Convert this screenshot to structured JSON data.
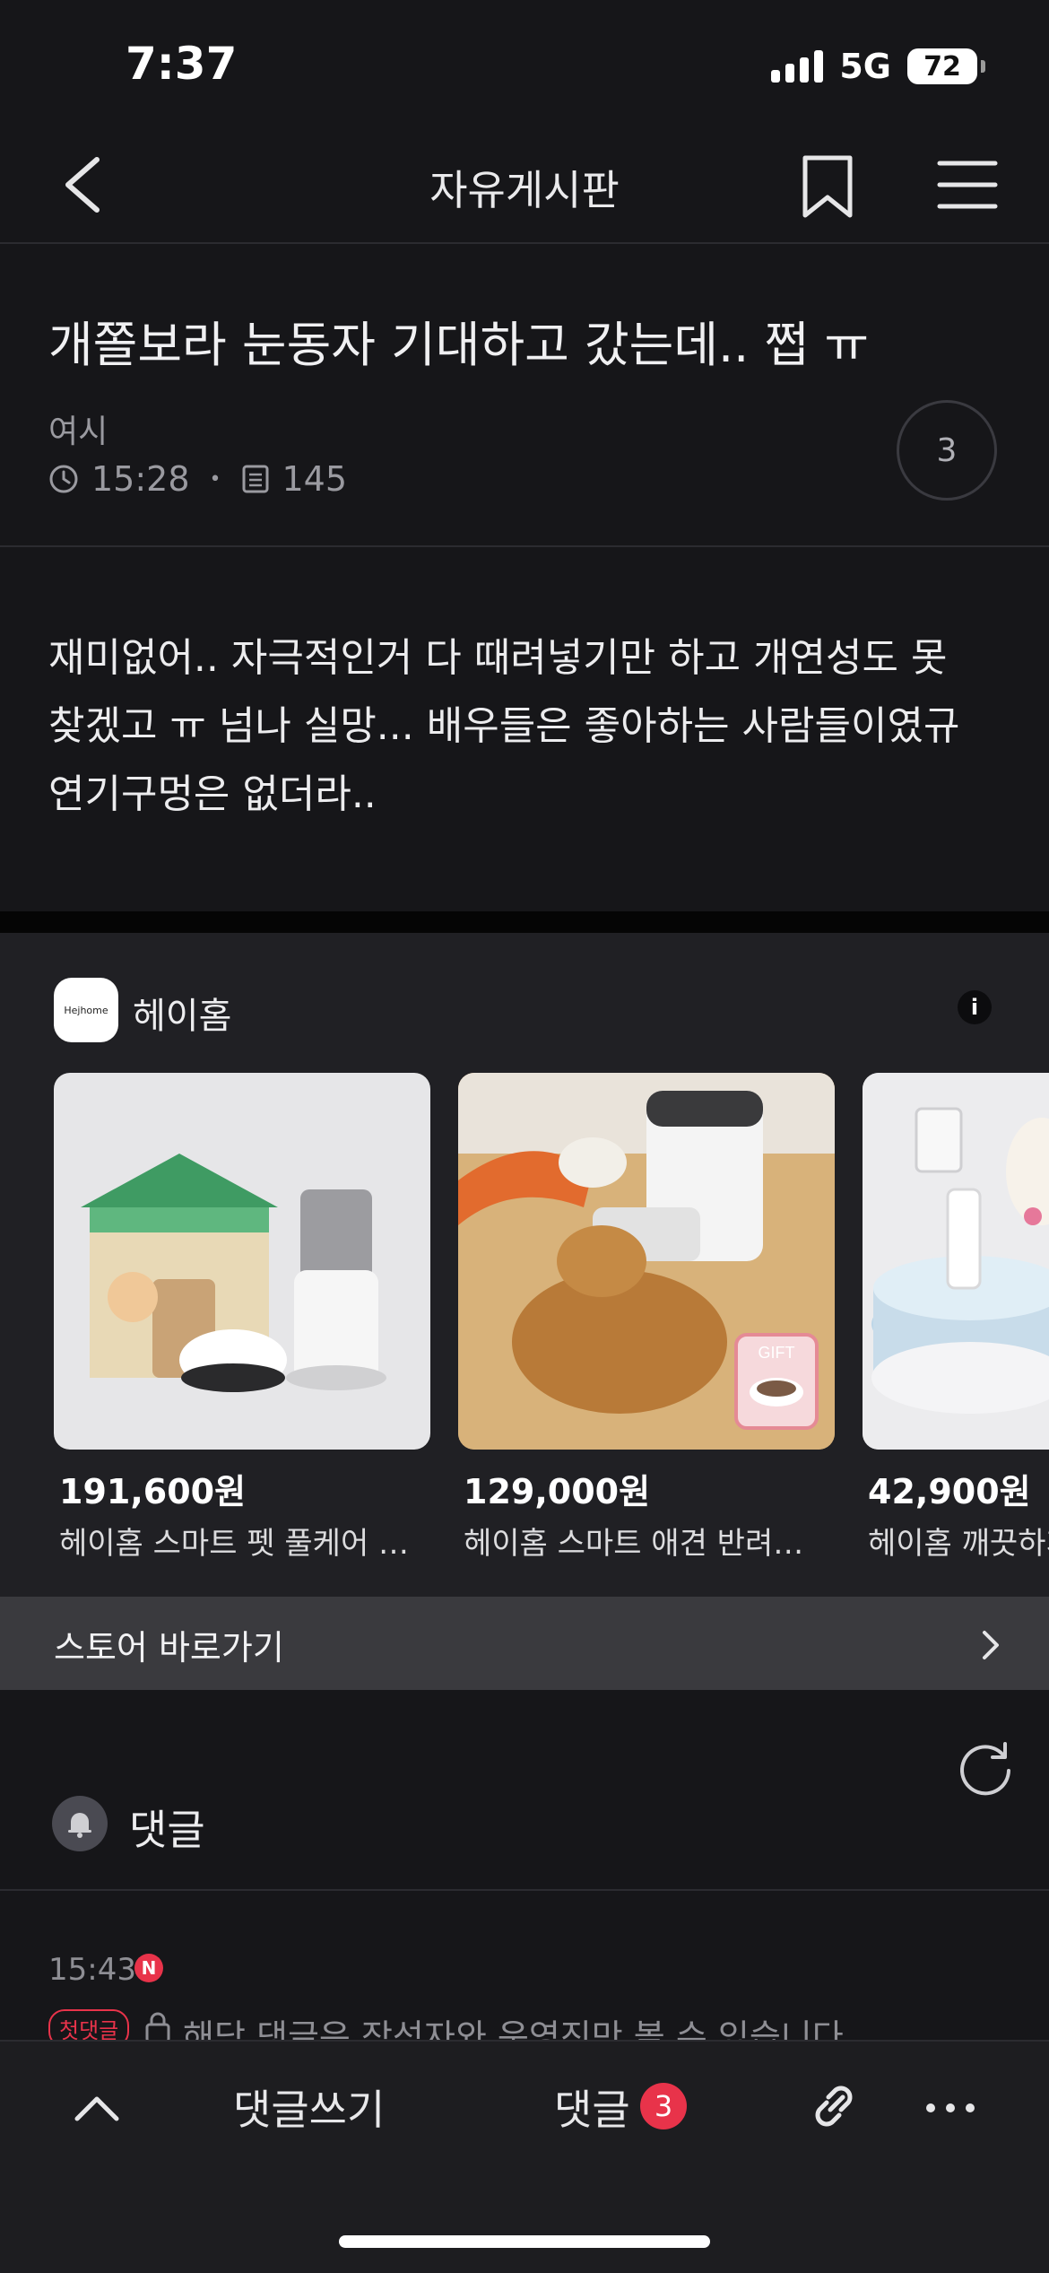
{
  "status_bar": {
    "time": "7:37",
    "network": "5G",
    "battery": "72"
  },
  "header": {
    "title": "자유게시판",
    "icons": [
      "chevron-left-icon",
      "bookmark-icon",
      "hamburger-menu-icon"
    ]
  },
  "post": {
    "title": "개쫄보라 눈동자 기대하고 갔는데.. 쩝 ㅠ",
    "author": "여시",
    "time": "15:28",
    "separator": "•",
    "views": "145",
    "comment_count": "3",
    "body_lines": [
      "재미없어.. 자극적인거 다 때려넣기만 하고 개연성도 못",
      "찾겠고 ㅠ 넘나 실망... 배우들은 좋아하는 사람들이였규",
      "연기구멍은 없더라.."
    ]
  },
  "ad": {
    "advertiser": "헤이홈",
    "logo_text": "Hejhome",
    "info_icon": "info-icon",
    "products": [
      {
        "price": "191,600원",
        "name": "헤이홈 스마트 펫 풀케어 세트"
      },
      {
        "price": "129,000원",
        "name": "헤이홈 스마트 애견 반려동물 급식기",
        "badge": "GIFT"
      },
      {
        "price": "42,900원",
        "name": "헤이홈 깨끗하게"
      }
    ],
    "store_link": "스토어 바로가기"
  },
  "comments": {
    "label": "댓글",
    "items": [
      {
        "time": "15:43",
        "new_badge": "N",
        "tag": "첫댓글",
        "text": "해당 댓글은 작성자와 운영진만 볼 수 있습니다"
      }
    ]
  },
  "bottom_bar": {
    "write": "댓글쓰기",
    "comments": "댓글",
    "count": "3"
  },
  "colors": {
    "background": "#161619",
    "accent_red": "#e8334a",
    "ad_background": "#202024"
  }
}
